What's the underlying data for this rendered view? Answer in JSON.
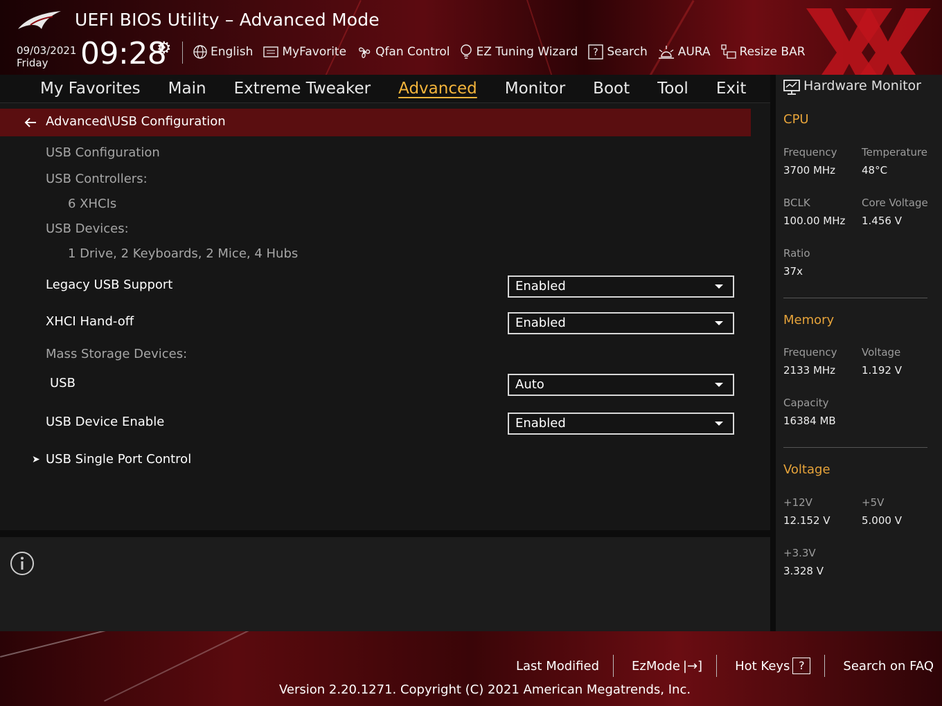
{
  "header": {
    "title": "UEFI BIOS Utility – Advanced Mode",
    "date": "09/03/2021",
    "day": "Friday",
    "time": "09:28",
    "tools": [
      {
        "label": "English",
        "icon": "globe-icon"
      },
      {
        "label": "MyFavorite",
        "icon": "favorite-list-icon"
      },
      {
        "label": "Qfan Control",
        "icon": "fan-icon"
      },
      {
        "label": "EZ Tuning Wizard",
        "icon": "lightbulb-icon"
      },
      {
        "label": "Search",
        "icon": "question-box-icon"
      },
      {
        "label": "AURA",
        "icon": "aura-light-icon"
      },
      {
        "label": "Resize BAR",
        "icon": "resize-bar-icon"
      }
    ]
  },
  "nav": {
    "tabs": [
      "My Favorites",
      "Main",
      "Extreme Tweaker",
      "Advanced",
      "Monitor",
      "Boot",
      "Tool",
      "Exit"
    ],
    "active": "Advanced"
  },
  "main": {
    "breadcrumb": "Advanced\\USB Configuration",
    "items": {
      "usb_configuration": "USB Configuration",
      "usb_controllers": "USB Controllers:",
      "usb_controllers_value": "6 XHCIs",
      "usb_devices": "USB Devices:",
      "usb_devices_value": "1 Drive, 2 Keyboards, 2 Mice, 4 Hubs",
      "legacy_usb_support": "Legacy USB Support",
      "legacy_usb_support_value": "Enabled",
      "xhci_handoff": "XHCI Hand-off",
      "xhci_handoff_value": "Enabled",
      "mass_storage_devices": "Mass Storage Devices:",
      "usb": "USB",
      "usb_value": "Auto",
      "usb_device_enable": "USB Device Enable",
      "usb_device_enable_value": "Enabled",
      "usb_single_port_control": "USB Single Port Control"
    }
  },
  "hardware_monitor": {
    "title": "Hardware Monitor",
    "cpu": {
      "heading": "CPU",
      "frequency_label": "Frequency",
      "frequency": "3700 MHz",
      "temperature_label": "Temperature",
      "temperature": "48°C",
      "bclk_label": "BCLK",
      "bclk": "100.00 MHz",
      "core_voltage_label": "Core Voltage",
      "core_voltage": "1.456 V",
      "ratio_label": "Ratio",
      "ratio": "37x"
    },
    "memory": {
      "heading": "Memory",
      "frequency_label": "Frequency",
      "frequency": "2133 MHz",
      "voltage_label": "Voltage",
      "voltage": "1.192 V",
      "capacity_label": "Capacity",
      "capacity": "16384 MB"
    },
    "voltage": {
      "heading": "Voltage",
      "v12_label": "+12V",
      "v12": "12.152 V",
      "v5_label": "+5V",
      "v5": "5.000 V",
      "v33_label": "+3.3V",
      "v33": "3.328 V"
    }
  },
  "footer": {
    "last_modified": "Last Modified",
    "ezmode": "EzMode",
    "ezmode_symbol": "|→]",
    "hot_keys": "Hot Keys",
    "hot_keys_symbol": "?",
    "search_faq": "Search on FAQ",
    "version": "Version 2.20.1271. Copyright (C) 2021 American Megatrends, Inc."
  },
  "colors": {
    "accent": "#f3b43b",
    "section_heading": "#e6a33a",
    "breadcrumb_bg": "#5a0e10",
    "brand_red": "#c0141c"
  }
}
